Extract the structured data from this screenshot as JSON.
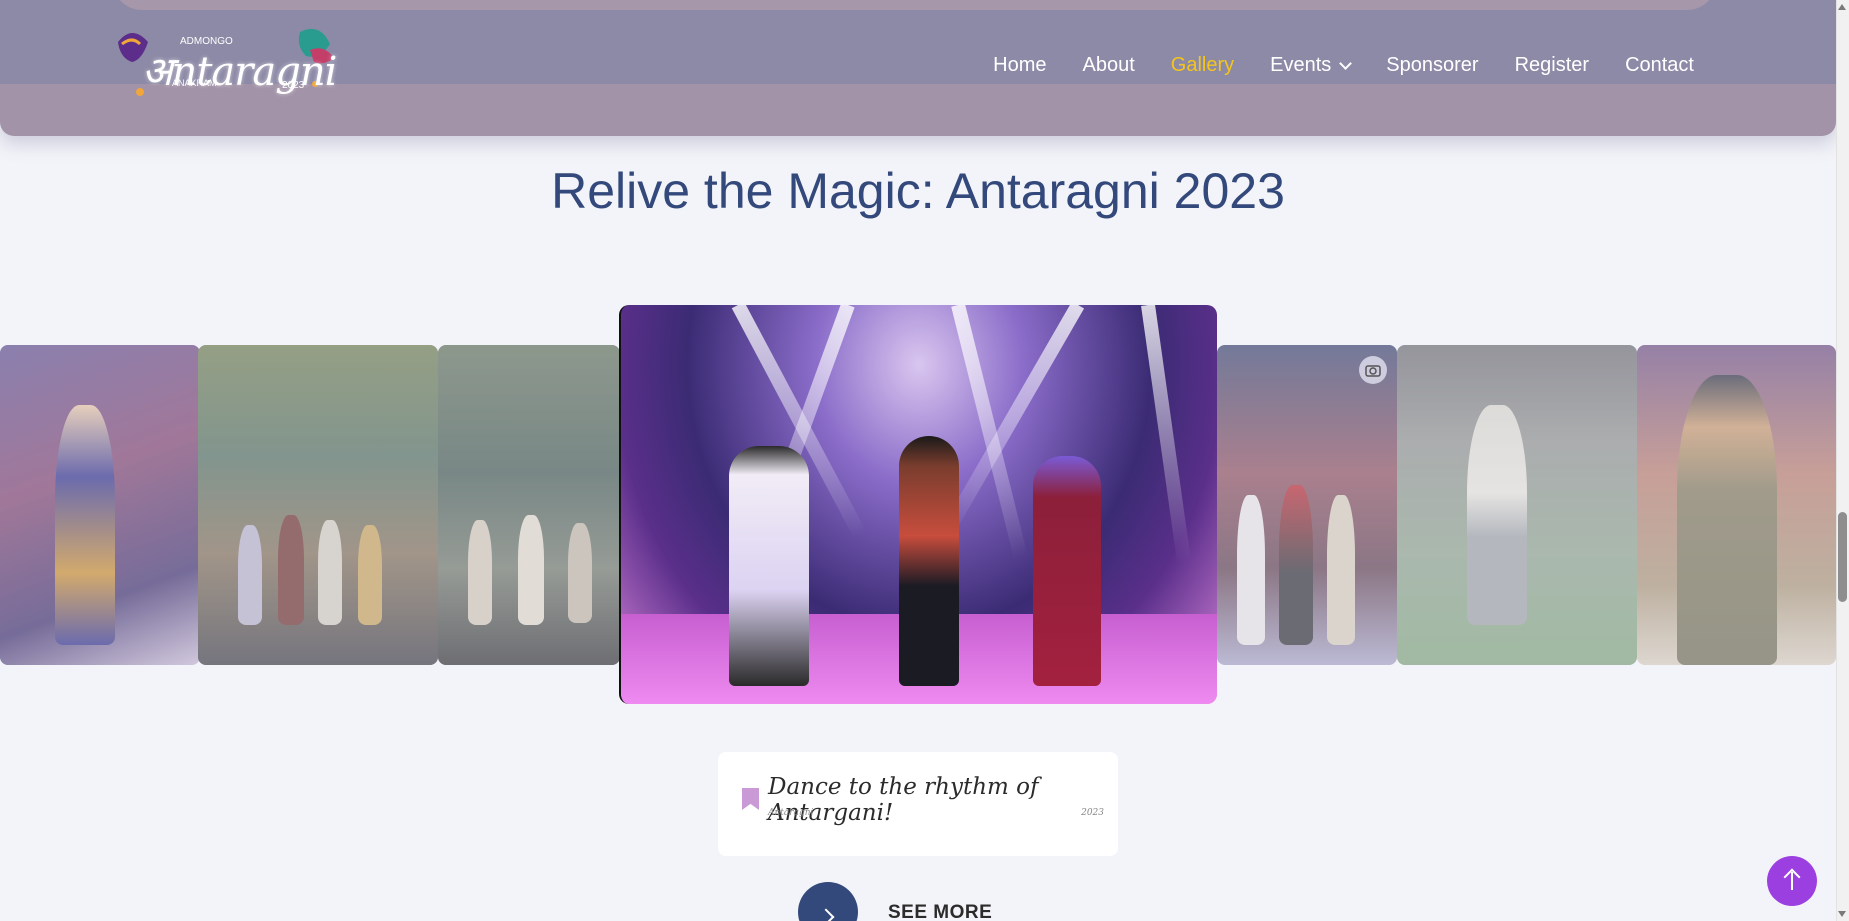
{
  "header": {
    "logo": {
      "main": "अntaragni",
      "small": "ADMONGO",
      "sub": "ANAKRAM",
      "year": "2023"
    },
    "nav": [
      {
        "label": "Home"
      },
      {
        "label": "About"
      },
      {
        "label": "Gallery",
        "active": true
      },
      {
        "label": "Events",
        "has_dropdown": true
      },
      {
        "label": "Sponsorer"
      },
      {
        "label": "Register"
      },
      {
        "label": "Contact"
      }
    ]
  },
  "section": {
    "title": "Relive the Magic: Antaragni 2023"
  },
  "caption": {
    "title": "Dance to the rhythm of Antargani!",
    "subtitle": "Antaragni",
    "year": "2023"
  },
  "see_more": {
    "label": "SEE MORE"
  },
  "colors": {
    "accent": "#34497b",
    "nav_active": "#f3c51c",
    "scroll_top": "#9c3fe0",
    "bookmark": "#c99ad6"
  },
  "icons": {
    "camera": "camera-icon",
    "bookmark": "bookmark-icon",
    "chevron": "chevron-down-icon",
    "arrow_right": "arrow-right-icon",
    "arrow_up": "arrow-up-icon"
  }
}
